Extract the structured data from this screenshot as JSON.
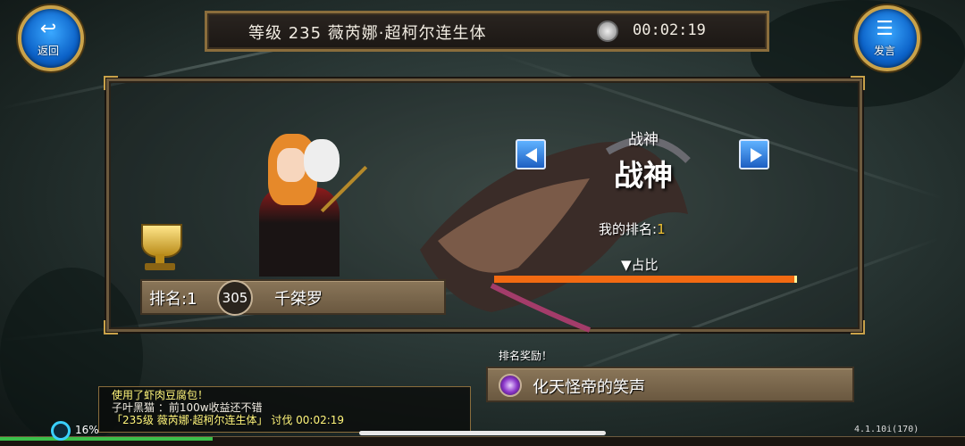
{
  "header": {
    "back_label": "返回",
    "chat_label": "发言",
    "title": "等级 235 薇芮娜·超柯尔连生体",
    "timer": "00:02:19"
  },
  "ranking": {
    "rank_label": "排名:1",
    "player_level": "305",
    "player_name": "千桀罗",
    "category_small": "战神",
    "category_big": "战神",
    "my_rank_label": "我的排名:",
    "my_rank_value": "1",
    "share_label": "▼占比",
    "share_fraction": 1.0
  },
  "reward": {
    "title": "排名奖励！",
    "name": "化天怪帝的笑声"
  },
  "chat": {
    "line1": "使用了虾肉豆腐包！",
    "line2": "子叶黑猫        ：前100w收益还不错",
    "line3": "「235级 薇芮娜·超柯尔连生体」 讨伐 00:02:19"
  },
  "status": {
    "progress_percent": "16%",
    "progress_fraction": 0.16,
    "version": "4.1.10i(170)"
  },
  "icons": {
    "back": "back-arrow-icon",
    "chat": "speech-bubble-icon",
    "timer": "stopwatch-icon",
    "trophy": "trophy-icon",
    "reward": "purple-orb-icon",
    "left": "left-arrow-icon",
    "right": "right-arrow-icon"
  },
  "colors": {
    "share_bar": "#f26a12",
    "my_rank_value": "#f0c233",
    "chat_highlight": "#fff57a",
    "button_blue": "#0c62c8",
    "gold_frame": "#c9a24a"
  }
}
